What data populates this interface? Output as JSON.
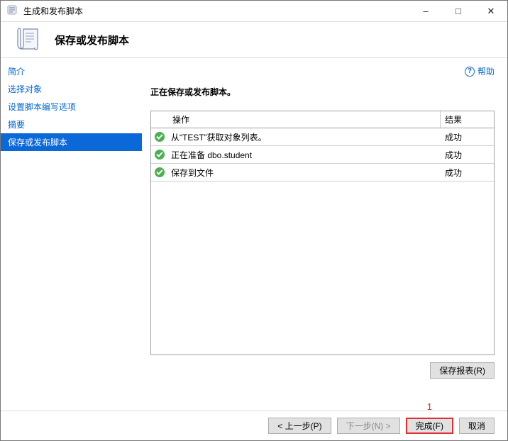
{
  "window": {
    "title": "生成和发布脚本"
  },
  "header": {
    "title": "保存或发布脚本"
  },
  "sidebar": {
    "items": [
      {
        "label": "简介"
      },
      {
        "label": "选择对象"
      },
      {
        "label": "设置脚本编写选项"
      },
      {
        "label": "摘要"
      },
      {
        "label": "保存或发布脚本"
      }
    ]
  },
  "main": {
    "help_label": "帮助",
    "progress_title": "正在保存或发布脚本。",
    "grid_headers": {
      "action": "操作",
      "result": "结果"
    },
    "rows": [
      {
        "action": "从“TEST”获取对象列表。",
        "result": "成功"
      },
      {
        "action": "正在准备 dbo.student",
        "result": "成功"
      },
      {
        "action": "保存到文件",
        "result": "成功"
      }
    ],
    "save_report_label": "保存报表(R)"
  },
  "footer": {
    "prev": "< 上一步(P)",
    "next": "下一步(N) >",
    "finish": "完成(F)",
    "cancel": "取消"
  },
  "annotation": {
    "marker": "1"
  }
}
